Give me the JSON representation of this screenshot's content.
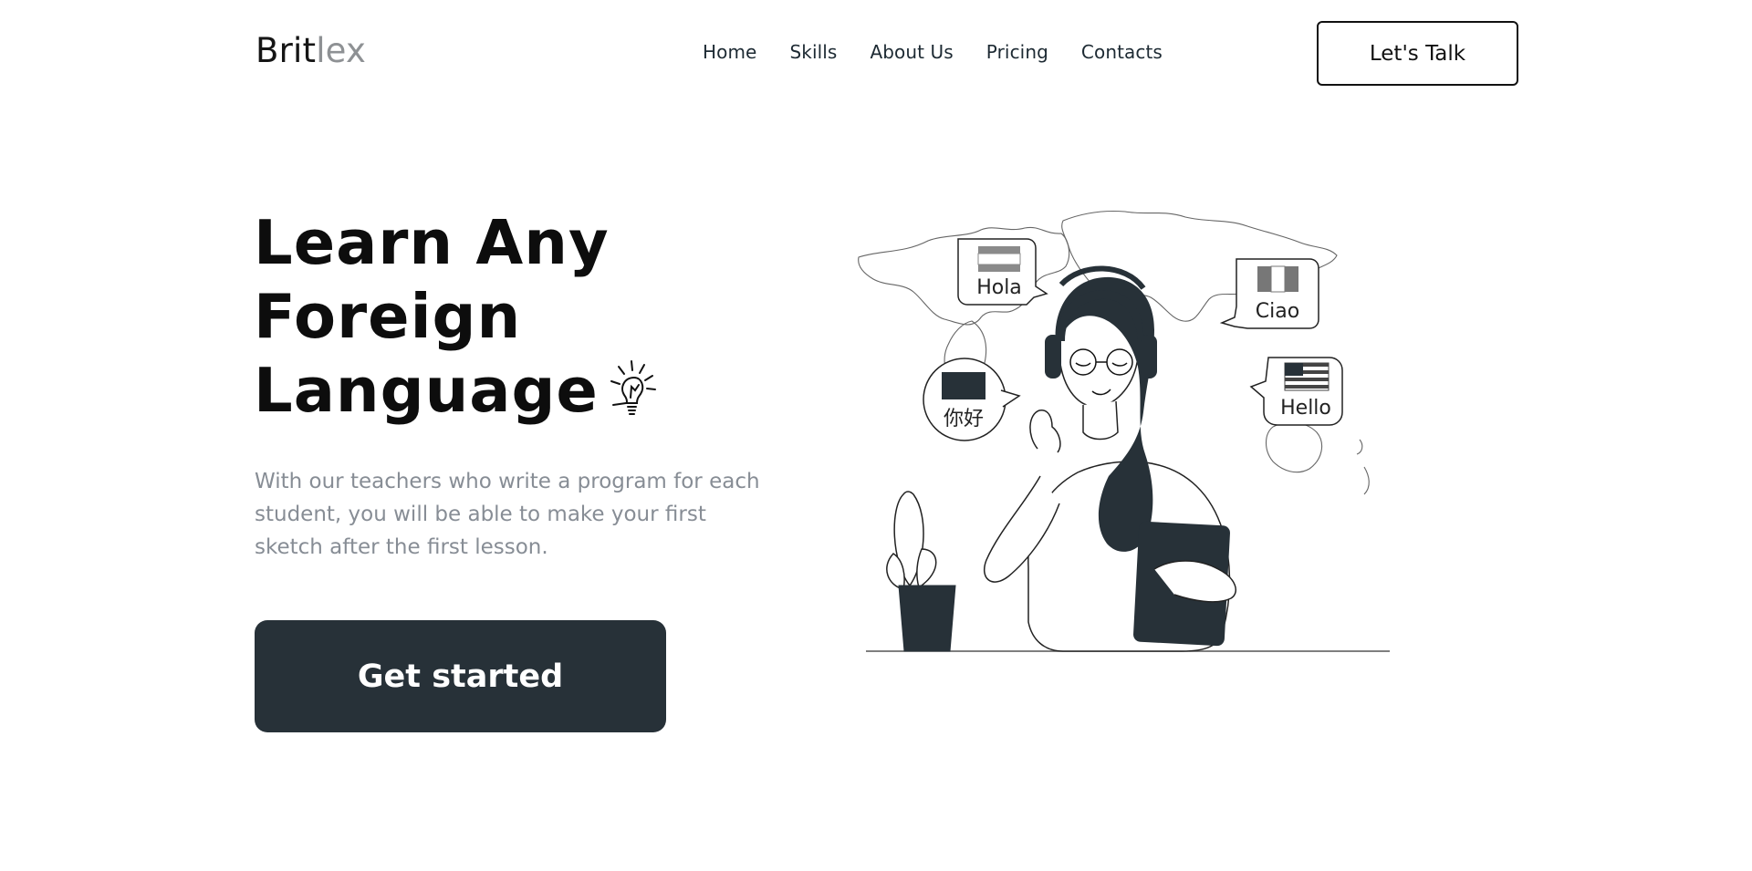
{
  "header": {
    "logo_part1": "Brit",
    "logo_part2": "lex",
    "nav": [
      "Home",
      "Skills",
      "About Us",
      "Pricing",
      "Contacts"
    ],
    "cta_label": "Let's Talk"
  },
  "hero": {
    "title_lines": [
      "Learn Any",
      "Foreign",
      "Language"
    ],
    "description": "With our teachers who write a program for each student, you will be able to make your first sketch after the first lesson.",
    "button_label": "Get started"
  },
  "illustration": {
    "bubbles": [
      "Hola",
      "Ciao",
      "你好",
      "Hello"
    ],
    "icons": [
      "lightbulb-icon",
      "headphones",
      "spain-flag-icon",
      "italy-flag-icon",
      "china-flag-icon",
      "usa-flag-icon",
      "plant"
    ]
  }
}
